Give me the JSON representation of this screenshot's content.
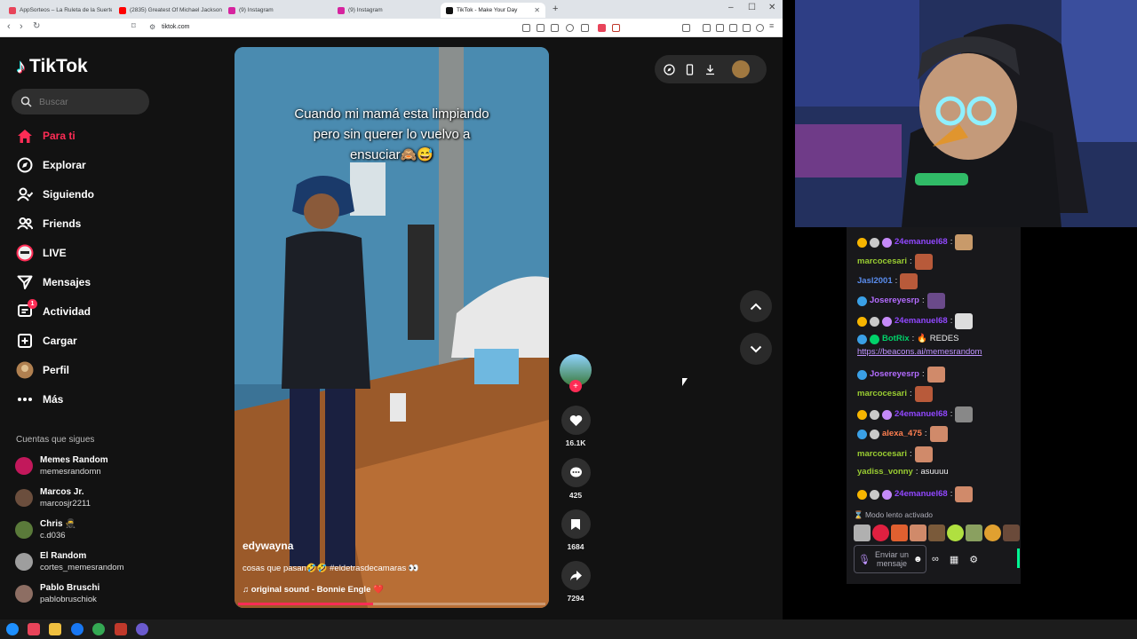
{
  "browser": {
    "tabs": [
      {
        "label": "AppSorteos – La Ruleta de la Suerte",
        "color": "#e8445a",
        "active": false
      },
      {
        "label": "(2835) Greatest Of Michael Jackson",
        "color": "#ff0000",
        "active": false
      },
      {
        "label": "(9) Instagram",
        "color": "#d6249f",
        "active": false
      },
      {
        "label": "(9) Instagram",
        "color": "#d6249f",
        "active": false
      },
      {
        "label": "TikTok - Make Your Day",
        "color": "#111111",
        "active": true
      }
    ],
    "url": "tiktok.com"
  },
  "tiktok": {
    "logo": "TikTok",
    "search_placeholder": "Buscar",
    "nav": [
      {
        "label": "Para ti",
        "icon": "home-icon",
        "active": true,
        "badge": ""
      },
      {
        "label": "Explorar",
        "icon": "compass-icon",
        "active": false,
        "badge": ""
      },
      {
        "label": "Siguiendo",
        "icon": "following-icon",
        "active": false,
        "badge": ""
      },
      {
        "label": "Friends",
        "icon": "friends-icon",
        "active": false,
        "badge": ""
      },
      {
        "label": "LIVE",
        "icon": "live-icon",
        "active": false,
        "badge": ""
      },
      {
        "label": "Mensajes",
        "icon": "send-icon",
        "active": false,
        "badge": ""
      },
      {
        "label": "Actividad",
        "icon": "inbox-icon",
        "active": false,
        "badge": "1"
      },
      {
        "label": "Cargar",
        "icon": "upload-icon",
        "active": false,
        "badge": ""
      },
      {
        "label": "Perfil",
        "icon": "profile-icon",
        "active": false,
        "badge": ""
      },
      {
        "label": "Más",
        "icon": "more-icon",
        "active": false,
        "badge": ""
      }
    ],
    "following_title": "Cuentas que sigues",
    "following": [
      {
        "name": "Memes Random",
        "handle": "memesrandomn",
        "color": "#c2185b"
      },
      {
        "name": "Marcos Jr.",
        "handle": "marcosjr2211",
        "color": "#6b4e3d"
      },
      {
        "name": "Chris 🥷",
        "handle": "c.d036",
        "color": "#5a7a3a"
      },
      {
        "name": "El Random",
        "handle": "cortes_memesrandom",
        "color": "#9e9e9e"
      },
      {
        "name": "Pablo Bruschi",
        "handle": "pablobruschiok",
        "color": "#8d6e63"
      }
    ],
    "video": {
      "caption": "Cuando mi mamá esta limpiando pero sin querer lo vuelvo a ensuciar🙈😅",
      "author": "edywayna",
      "description": "cosas que pasan🤣🤣 #eldetrasdecamaras 👀",
      "sound": "♫  original sound - Bonnie Engle ❤️",
      "progress": 0.44
    },
    "actions": {
      "likes": "16.1K",
      "comments": "425",
      "saves": "1684",
      "shares": "7294"
    }
  },
  "chat": {
    "messages": [
      {
        "user": "24emanuel68",
        "text": "",
        "color": "#9147ff",
        "badges": [
          "#f7b500",
          "#c9c9c9",
          "#c58af9"
        ],
        "emote": "#c89a6a"
      },
      {
        "user": "marcocesari",
        "text": "",
        "color": "#9acd32",
        "badges": [],
        "emote": "#b85a3a"
      },
      {
        "user": "Jasl2001",
        "text": "",
        "color": "#5a8dee",
        "badges": [],
        "emote": "#b85a3a"
      },
      {
        "user": "Josereyesrp",
        "text": "",
        "color": "#b36cff",
        "badges": [
          "#3aa0e6"
        ],
        "emote": "#6a4a8a"
      },
      {
        "user": "24emanuel68",
        "text": "",
        "color": "#9147ff",
        "badges": [
          "#f7b500",
          "#c9c9c9",
          "#c58af9"
        ],
        "emote": "#dddddd"
      },
      {
        "user": "BotRix",
        "text": "🔥 REDES",
        "color": "#00d26a",
        "badges": [
          "#3aa0e6",
          "#00d26a"
        ],
        "emote": ""
      },
      {
        "user": "",
        "text": "https://beacons.ai/memesrandom",
        "color": "#bf94ff",
        "badges": [],
        "emote": ""
      },
      {
        "user": "Josereyesrp",
        "text": "",
        "color": "#b36cff",
        "badges": [
          "#3aa0e6"
        ],
        "emote": "#d08a6a"
      },
      {
        "user": "marcocesari",
        "text": "",
        "color": "#9acd32",
        "badges": [],
        "emote": "#b85a3a"
      },
      {
        "user": "24emanuel68",
        "text": "",
        "color": "#9147ff",
        "badges": [
          "#f7b500",
          "#c9c9c9",
          "#c58af9"
        ],
        "emote": "#888888"
      },
      {
        "user": "alexa_475",
        "text": "",
        "color": "#ff7f50",
        "badges": [
          "#3aa0e6",
          "#c9c9c9"
        ],
        "emote": "#d08a6a"
      },
      {
        "user": "marcocesari",
        "text": "",
        "color": "#9acd32",
        "badges": [],
        "emote": "#d08a6a"
      },
      {
        "user": "yadiss_vonny",
        "text": "asuuuu",
        "color": "#9acd32",
        "badges": [],
        "emote": ""
      },
      {
        "user": "24emanuel68",
        "text": "",
        "color": "#9147ff",
        "badges": [
          "#f7b500",
          "#c9c9c9",
          "#c58af9"
        ],
        "emote": "#d08a6a"
      }
    ],
    "slow_mode": "Modo lento activado",
    "input_placeholder": "Enviar un mensaje"
  }
}
